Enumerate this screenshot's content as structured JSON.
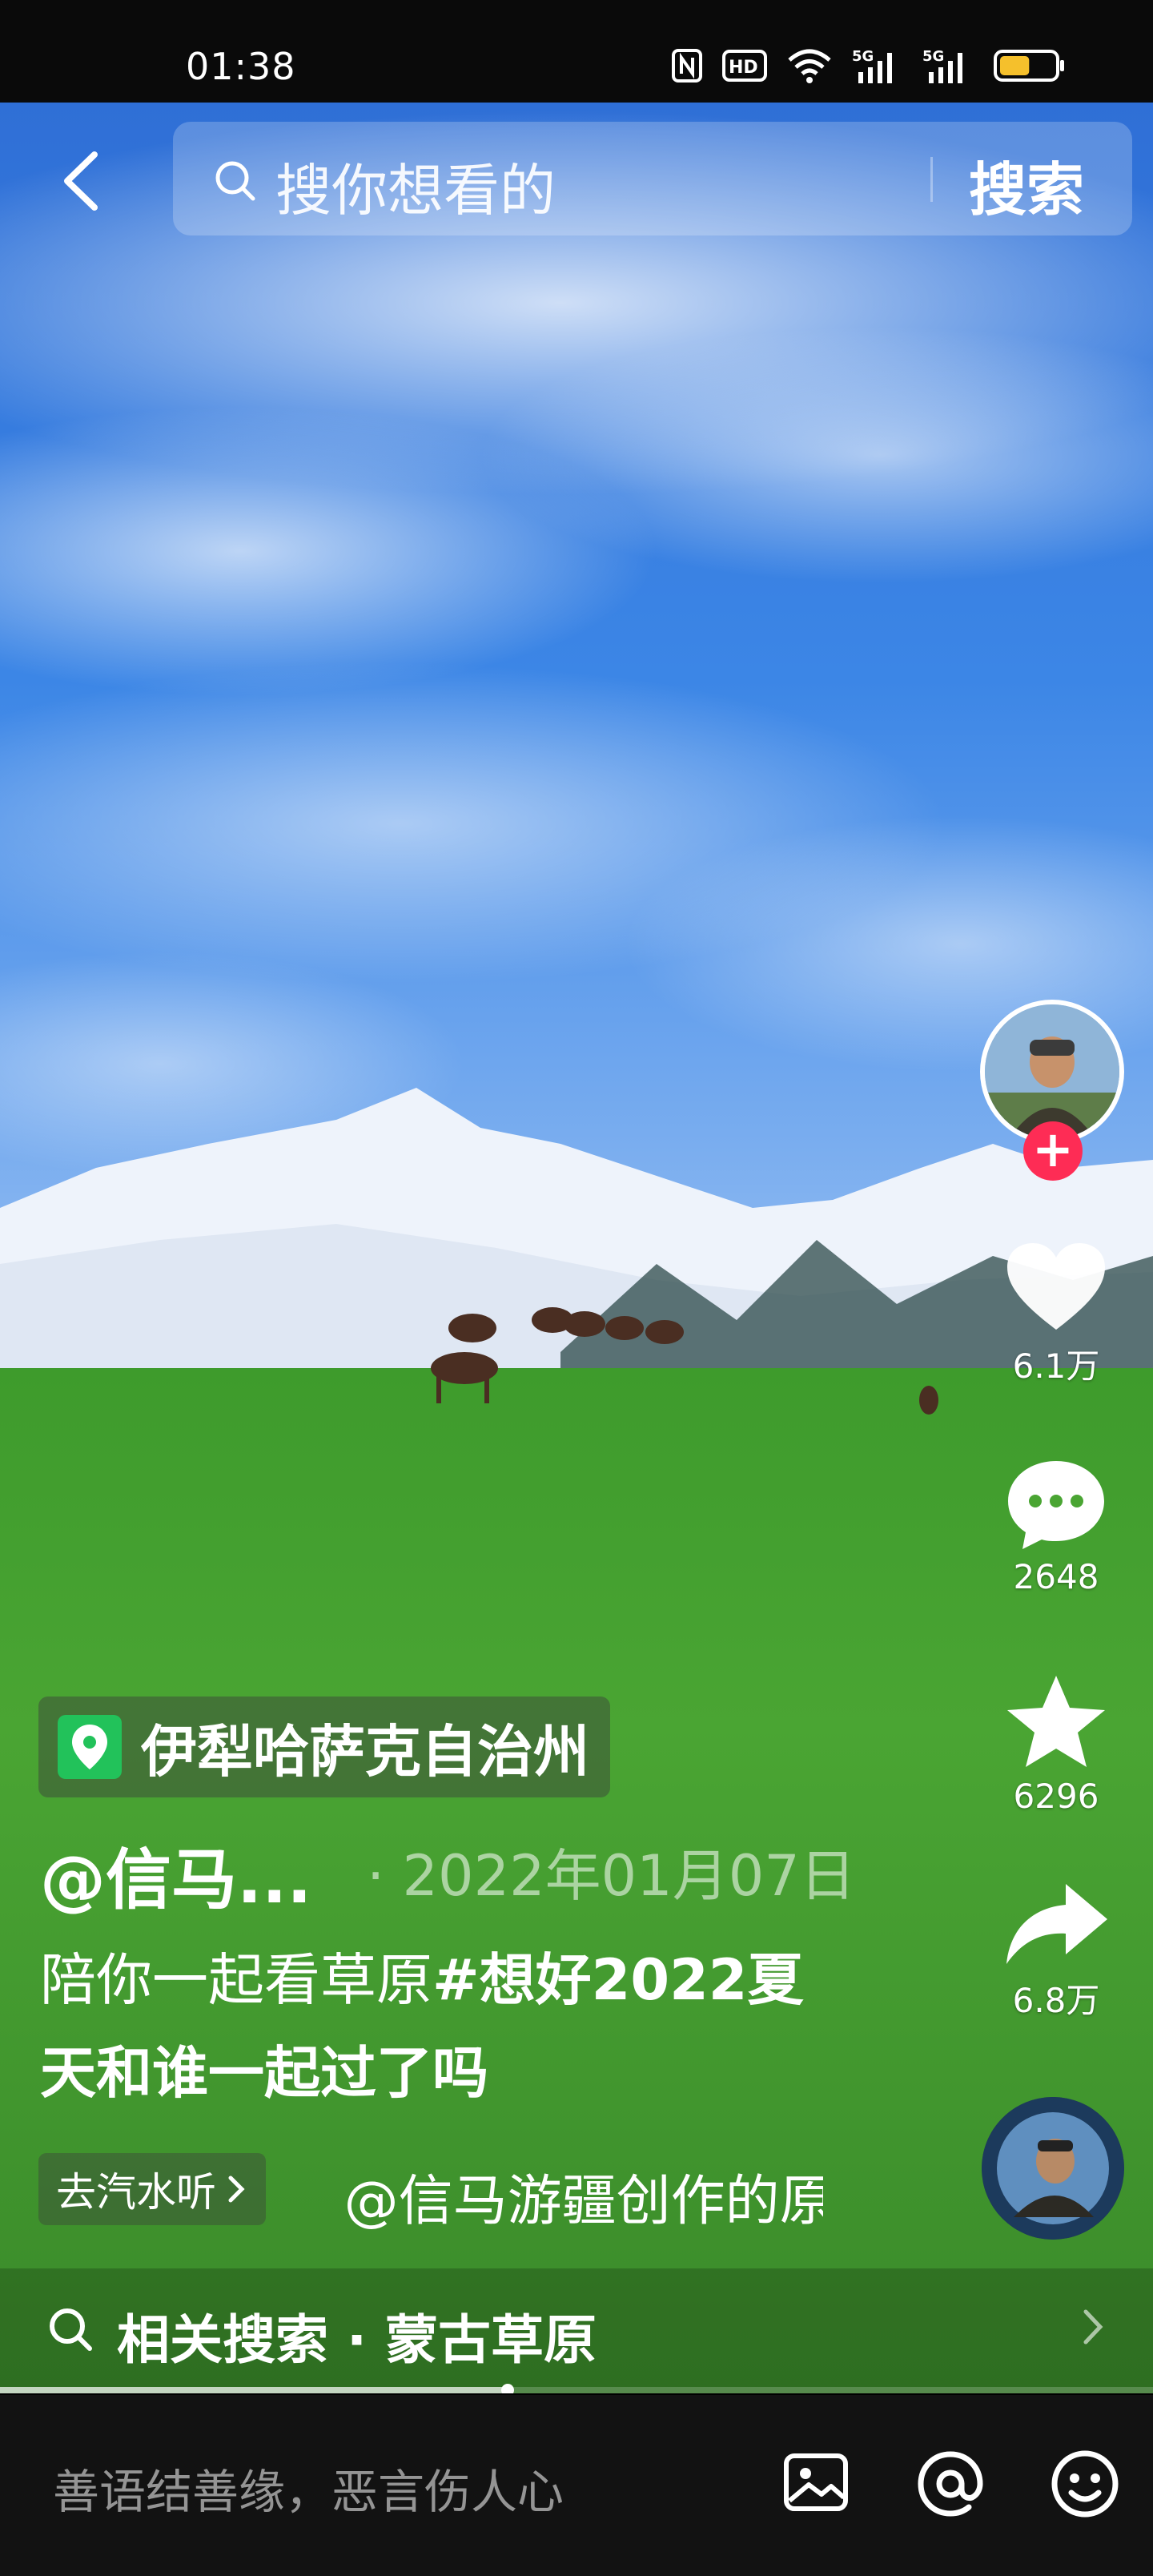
{
  "status_bar": {
    "time": "01:38",
    "battery_level": 0.55
  },
  "search": {
    "placeholder": "搜你想看的",
    "button_label": "搜索"
  },
  "actions": {
    "likes": "6.1万",
    "comments": "2648",
    "favorites": "6296",
    "shares": "6.8万"
  },
  "video": {
    "location": "伊犁哈萨克自治州",
    "author": "@信马...",
    "date": "· 2022年01月07日",
    "caption_text": "陪你一起看草原",
    "caption_hashtag": "#想好2022夏天和谁一起过了吗",
    "soda_button": "去汽水听",
    "music": "@信马游疆创作的原",
    "progress": 0.44
  },
  "related_search": {
    "label": "相关搜索 · 蒙古草原"
  },
  "comment": {
    "placeholder": "善语结善缘，恶言伤人心"
  },
  "colors": {
    "follow": "#fe2c55",
    "location_pin": "#22c25a",
    "battery": "#f5c02c"
  }
}
